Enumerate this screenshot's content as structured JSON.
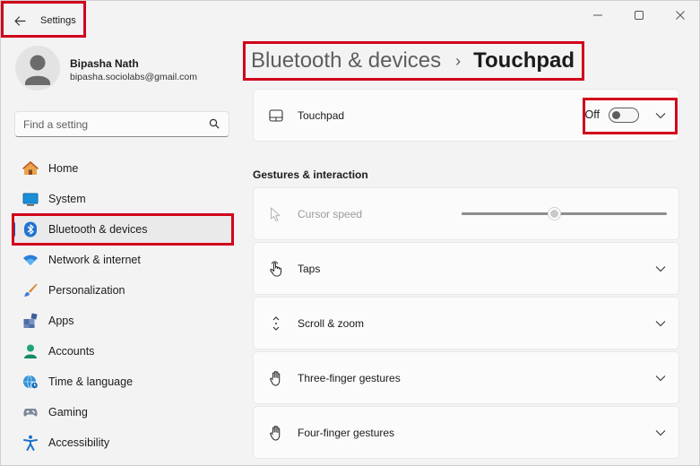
{
  "window": {
    "app_title": "Settings",
    "controls": [
      "minimize-icon",
      "maximize-icon",
      "close-icon"
    ]
  },
  "profile": {
    "name": "Bipasha Nath",
    "email": "bipasha.sociolabs@gmail.com"
  },
  "search": {
    "placeholder": "Find a setting",
    "value": ""
  },
  "sidebar": {
    "items": [
      {
        "label": "Home",
        "icon": "home-icon",
        "active": false
      },
      {
        "label": "System",
        "icon": "system-icon",
        "active": false
      },
      {
        "label": "Bluetooth & devices",
        "icon": "bluetooth-icon",
        "active": true
      },
      {
        "label": "Network & internet",
        "icon": "wifi-icon",
        "active": false
      },
      {
        "label": "Personalization",
        "icon": "brush-icon",
        "active": false
      },
      {
        "label": "Apps",
        "icon": "apps-icon",
        "active": false
      },
      {
        "label": "Accounts",
        "icon": "accounts-icon",
        "active": false
      },
      {
        "label": "Time & language",
        "icon": "globe-clock-icon",
        "active": false
      },
      {
        "label": "Gaming",
        "icon": "gamepad-icon",
        "active": false
      },
      {
        "label": "Accessibility",
        "icon": "accessibility-icon",
        "active": false
      }
    ]
  },
  "breadcrumb": {
    "parent": "Bluetooth & devices",
    "separator": "›",
    "current": "Touchpad"
  },
  "touchpad_card": {
    "label": "Touchpad",
    "toggle_state": "Off",
    "toggle_on": false
  },
  "section": {
    "title": "Gestures & interaction"
  },
  "cursor_speed": {
    "label": "Cursor speed",
    "value_fraction": 0.45,
    "disabled": true
  },
  "settings": [
    {
      "label": "Taps",
      "icon": "tap-icon"
    },
    {
      "label": "Scroll & zoom",
      "icon": "scroll-icon"
    },
    {
      "label": "Three-finger gestures",
      "icon": "hand-icon"
    },
    {
      "label": "Four-finger gestures",
      "icon": "hand-icon"
    }
  ],
  "colors": {
    "accent": "#0067c0",
    "highlight": "#d0021b"
  }
}
